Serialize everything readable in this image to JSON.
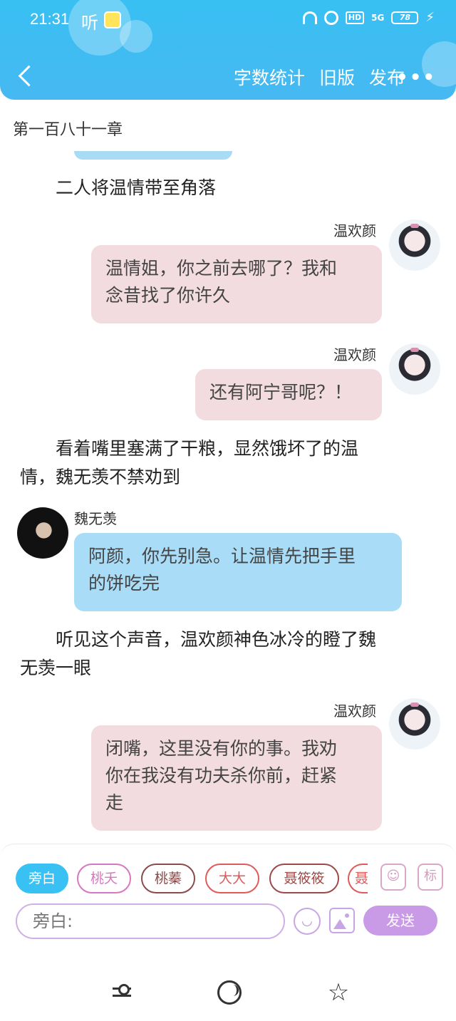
{
  "status_bar": {
    "time": "21:31",
    "listen": "听",
    "hd": "HD",
    "signal": "5G",
    "battery": "78"
  },
  "nav": {
    "word_count": "字数统计",
    "old_version": "旧版",
    "publish": "发布"
  },
  "chapter_title": "第一百八十一章",
  "messages": {
    "narration_1": "二人将温情带至角落",
    "msg_1_speaker": "温欢颜",
    "msg_1_line1": "温情姐，你之前去哪了？我和",
    "msg_1_line2": "念昔找了你许久",
    "msg_2_speaker": "温欢颜",
    "msg_2_text": "还有阿宁哥呢？！",
    "narration_2_line1": "看着嘴里塞满了干粮，显然饿坏了的温",
    "narration_2_line2": "情，魏无羡不禁劝到",
    "msg_3_speaker": "魏无羡",
    "msg_3_line1": "阿颜，你先别急。让温情先把手里",
    "msg_3_line2": "的饼吃完",
    "narration_3_line1": "听见这个声音，温欢颜神色冰冷的瞪了魏",
    "narration_3_line2": "无羡一眼",
    "msg_4_speaker": "温欢颜",
    "msg_4_line1": "闭嘴，这里没有你的事。我劝",
    "msg_4_line2": "你在我没有功夫杀你前，赶紧",
    "msg_4_line3": "走"
  },
  "roles": [
    "旁白",
    "桃夭",
    "桃蓁",
    "大大",
    "聂筱筱",
    "聂"
  ],
  "role_chip_colors": {
    "active_bg": "#39c1f3",
    "taoyao": "#d777c2",
    "taozhen": "#8a4b4b",
    "dada": "#e05a5a",
    "nie": "#a04848"
  },
  "side_buttons": {
    "tag": "标"
  },
  "input": {
    "placeholder": "旁白:",
    "send_label": "发送"
  },
  "icons": {
    "back": "back-icon",
    "more": "more-icon",
    "emoji": "emoji-icon",
    "image": "image-icon",
    "person_card": "person-card-icon",
    "settings": "settings-icon",
    "circle": "circle-icon",
    "star": "star-icon"
  }
}
